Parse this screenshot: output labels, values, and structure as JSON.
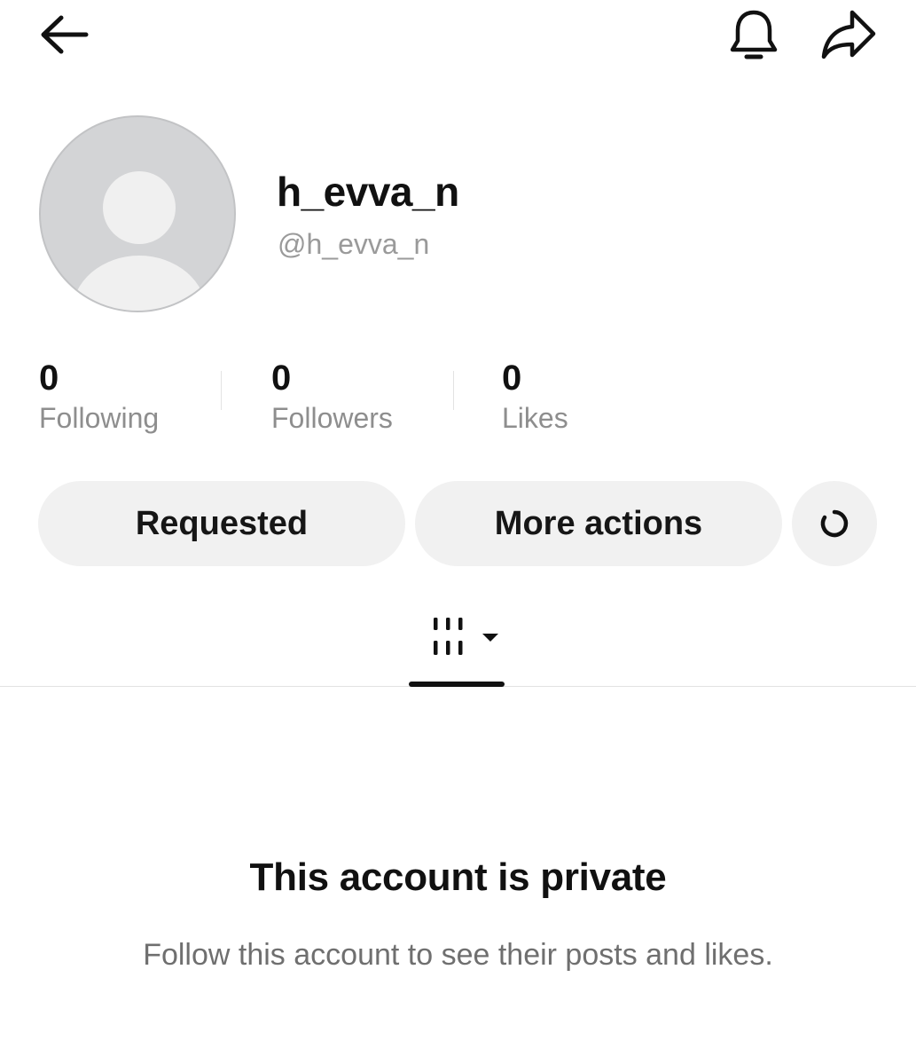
{
  "topbar": {
    "back_icon": "arrow-left-icon",
    "bell_icon": "bell-icon",
    "share_icon": "share-arrow-icon"
  },
  "profile": {
    "display_name": "h_evva_n",
    "handle": "@h_evva_n",
    "avatar_icon": "default-avatar-icon"
  },
  "stats": [
    {
      "value": "0",
      "label": "Following"
    },
    {
      "value": "0",
      "label": "Followers"
    },
    {
      "value": "0",
      "label": "Likes"
    }
  ],
  "actions": {
    "requested_label": "Requested",
    "more_actions_label": "More actions",
    "loading_icon": "loading-spinner-icon"
  },
  "tabs": {
    "active_tab_icon": "videos-grid-icon",
    "dropdown_icon": "caret-down-icon"
  },
  "private_notice": {
    "title": "This account is private",
    "message": "Follow this account to see their posts and likes."
  },
  "colors": {
    "text_primary": "#111111",
    "text_secondary": "#8e8e8e",
    "button_bg": "#f1f1f1",
    "avatar_bg": "#d3d4d6"
  }
}
